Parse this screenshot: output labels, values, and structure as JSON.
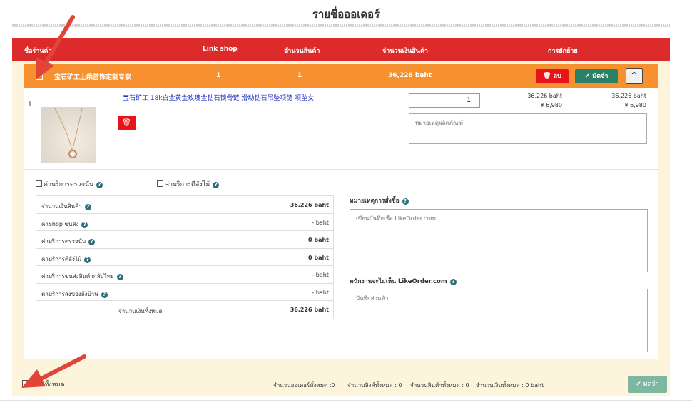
{
  "page": {
    "title": "รายชื่อออเดอร์"
  },
  "header": {
    "shop_name": "ชื่อร้านค้า",
    "link_shop": "Link shop",
    "quantity": "จำนวนสินค้า",
    "amount": "จำนวนเงินสินค้า",
    "move": "การยักย้าย"
  },
  "shop": {
    "name": "宝石矿工上乘首饰定制专家",
    "link_count": "1",
    "quantity": "1",
    "amount": "36,226 baht",
    "delete_label": "ลบ",
    "deposit_label": "มัดจำ",
    "collapse_icon": "chevron-up-icon"
  },
  "item": {
    "index": "1.",
    "title": "宝石矿工 18k白金黄金玫瑰金钻石锁骨链 滑动钻石吊坠项链 项坠女",
    "quantity": "1",
    "price_baht_unit": "36,226 baht",
    "price_yuan_unit": "¥  6,980",
    "price_baht_total": "36,226 baht",
    "price_yuan_total": "¥  6,980",
    "note_placeholder": "หมายเหตุผลิตภัณฑ์"
  },
  "services": {
    "inspection": "ค่าบริการตรวจนับ",
    "wood_crate": "ค่าบริการตีลังไม้"
  },
  "summary": [
    {
      "label": "จำนวนเงินสินค้า",
      "value": "36,226 baht",
      "bold": true
    },
    {
      "label": "ค่าShop ขนส่ง",
      "value": "- baht",
      "bold": false
    },
    {
      "label": "ค่าบริการตรวจนับ",
      "value": "0 baht",
      "bold": true
    },
    {
      "label": "ค่าบริการตีลังไม้",
      "value": "0 baht",
      "bold": true
    },
    {
      "label": "ค่าบริการขนส่งสินค้ากลับไทย",
      "value": "- baht",
      "bold": false
    },
    {
      "label": "ค่าบริการส่งของถึงบ้าน",
      "value": "- baht",
      "bold": false
    }
  ],
  "total": {
    "label": "จำนวนเงินทั้งหมด",
    "value": "36,226 baht"
  },
  "order_remark": {
    "label": "หมายเหตุการสั่งซื้อ",
    "placeholder": "เขียนบันทึกเพื่อ LikeOrder.com"
  },
  "private_note": {
    "label": "พนักงานจะไม่เห็น LikeOrder.com",
    "placeholder": "บันทึกส่วนตัว"
  },
  "footer": {
    "select_all": "เลือกทั้งหมด",
    "total_orders": "จำนวนออเดอร์ทั้งหมด :0",
    "total_links": "จำนวนลิงค์ทั้งหมด : 0",
    "total_items": "จำนวนสินค้าทั้งหมด : 0",
    "total_amount": "จำนวนเงินทั้งหมด : 0 baht",
    "deposit_label": "มัดจำ"
  },
  "colors": {
    "header_red": "#dd2a2a",
    "shop_orange": "#f7902e",
    "delete_red": "#e8141a",
    "deposit_green": "#2b8068",
    "annotation_arrow": "#e0453a"
  }
}
